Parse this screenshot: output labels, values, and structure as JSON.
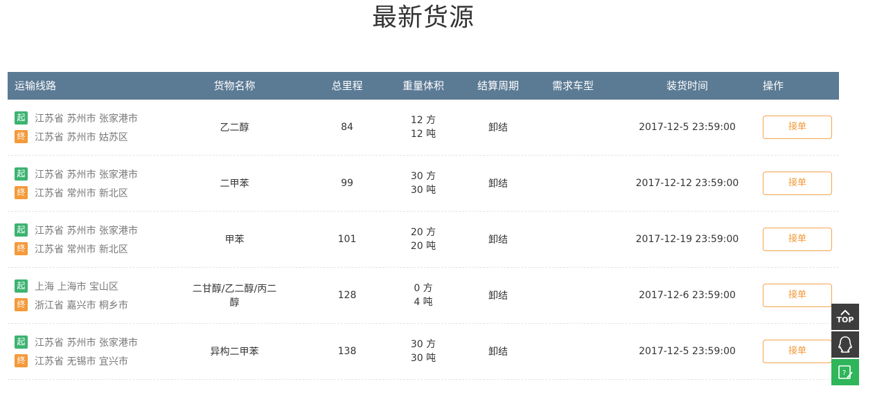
{
  "page_title": "最新货源",
  "headers": {
    "route": "运输线路",
    "goods": "货物名称",
    "distance": "总里程",
    "weight_volume": "重量体积",
    "cycle": "结算周期",
    "car_type": "需求车型",
    "load_time": "装货时间",
    "operation": "操作"
  },
  "tags": {
    "start": "起",
    "end": "终"
  },
  "rows": [
    {
      "from": "江苏省 苏州市 张家港市",
      "to": "江苏省 苏州市 姑苏区",
      "goods": "乙二醇",
      "distance": "84",
      "volume": "12 方",
      "weight": "12 吨",
      "cycle": "卸结",
      "car_type": "",
      "load_time": "2017-12-5 23:59:00",
      "action": "接单"
    },
    {
      "from": "江苏省 苏州市 张家港市",
      "to": "江苏省 常州市 新北区",
      "goods": "二甲苯",
      "distance": "99",
      "volume": "30 方",
      "weight": "30 吨",
      "cycle": "卸结",
      "car_type": "",
      "load_time": "2017-12-12 23:59:00",
      "action": "接单"
    },
    {
      "from": "江苏省 苏州市 张家港市",
      "to": "江苏省 常州市 新北区",
      "goods": "甲苯",
      "distance": "101",
      "volume": "20 方",
      "weight": "20 吨",
      "cycle": "卸结",
      "car_type": "",
      "load_time": "2017-12-19 23:59:00",
      "action": "接单"
    },
    {
      "from": "上海 上海市 宝山区",
      "to": "浙江省 嘉兴市 桐乡市",
      "goods": "二甘醇/乙二醇/丙二醇",
      "distance": "128",
      "volume": "0 方",
      "weight": "4 吨",
      "cycle": "卸结",
      "car_type": "",
      "load_time": "2017-12-6 23:59:00",
      "action": "接单"
    },
    {
      "from": "江苏省 苏州市 张家港市",
      "to": "江苏省 无锡市 宜兴市",
      "goods": "异构二甲苯",
      "distance": "138",
      "volume": "30 方",
      "weight": "30 吨",
      "cycle": "卸结",
      "car_type": "",
      "load_time": "2017-12-5 23:59:00",
      "action": "接单"
    }
  ],
  "sidebar": {
    "top_label": "TOP",
    "icons": [
      "arrow-up-icon",
      "qq-icon",
      "edit-help-icon"
    ]
  },
  "colors": {
    "header_bg": "#5b7a94",
    "start_tag": "#3cb371",
    "end_tag": "#f39a3a",
    "button_accent": "#f39a3a",
    "sidebar_dark": "#3d3d3d",
    "sidebar_green": "#2fb55a"
  }
}
